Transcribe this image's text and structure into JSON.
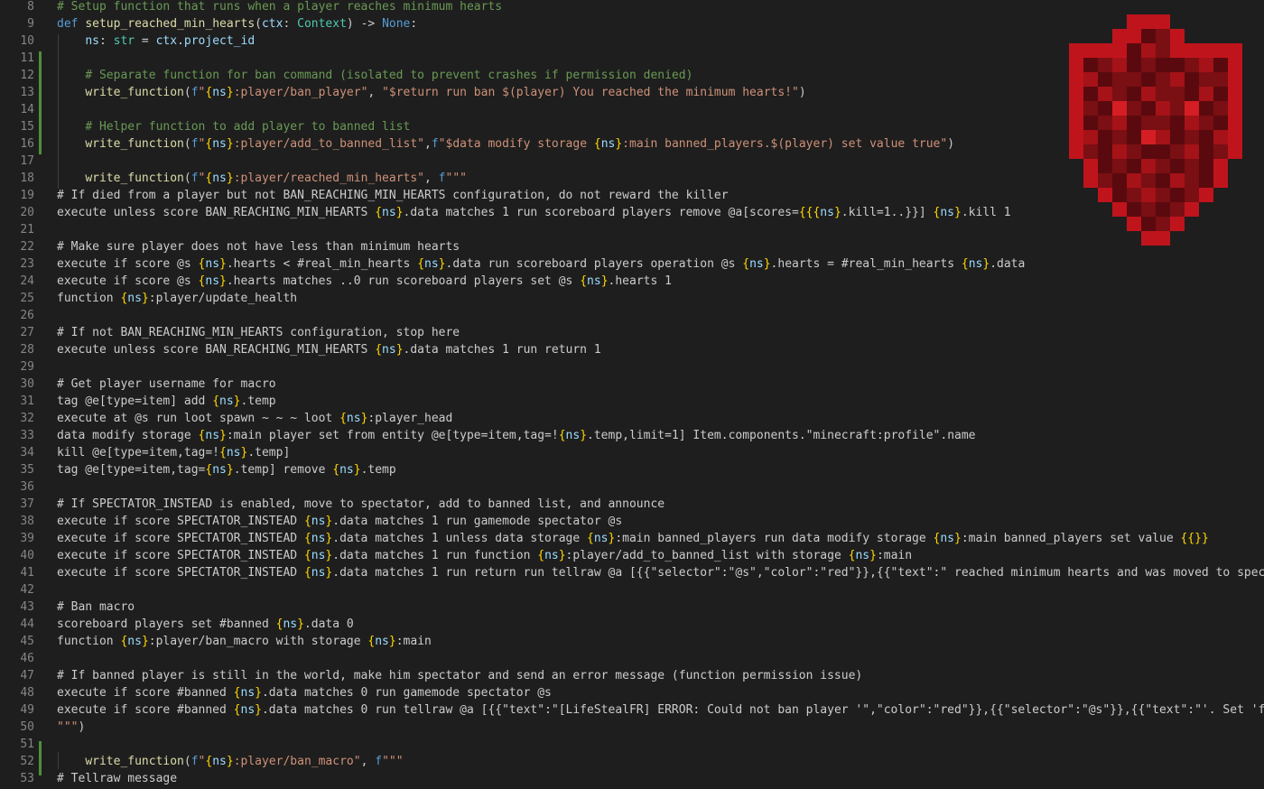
{
  "colors": {
    "background": "#1e1e1e",
    "line_number": "#858585",
    "comment": "#6a9955",
    "keyword": "#569cd6",
    "function": "#dcdcaa",
    "parameter": "#9cdcfe",
    "string": "#ce9178",
    "type": "#4ec9b0",
    "default": "#cccccc",
    "brace": "#ffd700",
    "added_line_marker": "#4e8f3a"
  },
  "logo_icon": "red-pixel-heart-shield-icon",
  "lines": [
    {
      "num": "8",
      "tokens": [
        {
          "c": "c",
          "text": "# Setup function that runs when a player reaches minimum hearts"
        }
      ]
    },
    {
      "num": "9",
      "tokens": [
        {
          "c": "k",
          "text": "def "
        },
        {
          "c": "f",
          "text": "setup_reached_min_hearts"
        },
        {
          "c": "d",
          "text": "("
        },
        {
          "c": "p",
          "text": "ctx"
        },
        {
          "c": "d",
          "text": ": "
        },
        {
          "c": "t",
          "text": "Context"
        },
        {
          "c": "d",
          "text": ") -> "
        },
        {
          "c": "n",
          "text": "None"
        },
        {
          "c": "d",
          "text": ":"
        }
      ]
    },
    {
      "num": "10",
      "tokens": [
        {
          "c": "d",
          "text": "    "
        },
        {
          "c": "p",
          "text": "ns"
        },
        {
          "c": "d",
          "text": ": "
        },
        {
          "c": "t",
          "text": "str"
        },
        {
          "c": "d",
          "text": " = "
        },
        {
          "c": "p",
          "text": "ctx"
        },
        {
          "c": "d",
          "text": "."
        },
        {
          "c": "p",
          "text": "project_id"
        }
      ]
    },
    {
      "num": "11",
      "tokens": []
    },
    {
      "num": "12",
      "tokens": [
        {
          "c": "d",
          "text": "    "
        },
        {
          "c": "c",
          "text": "# Separate function for ban command (isolated to prevent crashes if permission denied)"
        }
      ]
    },
    {
      "num": "13",
      "tokens": [
        {
          "c": "d",
          "text": "    "
        },
        {
          "c": "f",
          "text": "write_function"
        },
        {
          "c": "d",
          "text": "("
        },
        {
          "c": "k",
          "text": "f"
        },
        {
          "c": "s",
          "text": "\""
        },
        {
          "c": "y",
          "text": "{"
        },
        {
          "c": "p",
          "text": "ns"
        },
        {
          "c": "y",
          "text": "}"
        },
        {
          "c": "s",
          "text": ":player/ban_player\""
        },
        {
          "c": "d",
          "text": ", "
        },
        {
          "c": "s",
          "text": "\"$return run ban $(player) You reached the minimum hearts!\""
        },
        {
          "c": "d",
          "text": ")"
        }
      ]
    },
    {
      "num": "14",
      "tokens": []
    },
    {
      "num": "15",
      "tokens": [
        {
          "c": "d",
          "text": "    "
        },
        {
          "c": "c",
          "text": "# Helper function to add player to banned list"
        }
      ]
    },
    {
      "num": "16",
      "tokens": [
        {
          "c": "d",
          "text": "    "
        },
        {
          "c": "f",
          "text": "write_function"
        },
        {
          "c": "d",
          "text": "("
        },
        {
          "c": "k",
          "text": "f"
        },
        {
          "c": "s",
          "text": "\""
        },
        {
          "c": "y",
          "text": "{"
        },
        {
          "c": "p",
          "text": "ns"
        },
        {
          "c": "y",
          "text": "}"
        },
        {
          "c": "s",
          "text": ":player/add_to_banned_list\""
        },
        {
          "c": "d",
          "text": ","
        },
        {
          "c": "k",
          "text": "f"
        },
        {
          "c": "s",
          "text": "\"$data modify storage "
        },
        {
          "c": "y",
          "text": "{"
        },
        {
          "c": "p",
          "text": "ns"
        },
        {
          "c": "y",
          "text": "}"
        },
        {
          "c": "s",
          "text": ":main banned_players.$(player) set value true\""
        },
        {
          "c": "d",
          "text": ")"
        }
      ]
    },
    {
      "num": "17",
      "tokens": []
    },
    {
      "num": "18",
      "tokens": [
        {
          "c": "d",
          "text": "    "
        },
        {
          "c": "f",
          "text": "write_function"
        },
        {
          "c": "d",
          "text": "("
        },
        {
          "c": "k",
          "text": "f"
        },
        {
          "c": "s",
          "text": "\""
        },
        {
          "c": "y",
          "text": "{"
        },
        {
          "c": "p",
          "text": "ns"
        },
        {
          "c": "y",
          "text": "}"
        },
        {
          "c": "s",
          "text": ":player/reached_min_hearts\""
        },
        {
          "c": "d",
          "text": ", "
        },
        {
          "c": "k",
          "text": "f"
        },
        {
          "c": "s",
          "text": "\"\"\""
        }
      ]
    },
    {
      "num": "19",
      "tokens": [
        {
          "c": "d",
          "text": "# If died from a player but not BAN_REACHING_MIN_HEARTS configuration, do not reward the killer"
        }
      ]
    },
    {
      "num": "20",
      "tokens": [
        {
          "c": "d",
          "text": "execute unless score BAN_REACHING_MIN_HEARTS "
        },
        {
          "c": "y",
          "text": "{"
        },
        {
          "c": "p",
          "text": "ns"
        },
        {
          "c": "y",
          "text": "}"
        },
        {
          "c": "d",
          "text": ".data matches 1 run scoreboard players remove @a[scores="
        },
        {
          "c": "y",
          "text": "{{{"
        },
        {
          "c": "p",
          "text": "ns"
        },
        {
          "c": "y",
          "text": "}"
        },
        {
          "c": "d",
          "text": ".kill=1..}}] "
        },
        {
          "c": "y",
          "text": "{"
        },
        {
          "c": "p",
          "text": "ns"
        },
        {
          "c": "y",
          "text": "}"
        },
        {
          "c": "d",
          "text": ".kill 1"
        }
      ]
    },
    {
      "num": "21",
      "tokens": []
    },
    {
      "num": "22",
      "tokens": [
        {
          "c": "d",
          "text": "# Make sure player does not have less than minimum hearts"
        }
      ]
    },
    {
      "num": "23",
      "tokens": [
        {
          "c": "d",
          "text": "execute if score @s "
        },
        {
          "c": "y",
          "text": "{"
        },
        {
          "c": "p",
          "text": "ns"
        },
        {
          "c": "y",
          "text": "}"
        },
        {
          "c": "d",
          "text": ".hearts < #real_min_hearts "
        },
        {
          "c": "y",
          "text": "{"
        },
        {
          "c": "p",
          "text": "ns"
        },
        {
          "c": "y",
          "text": "}"
        },
        {
          "c": "d",
          "text": ".data run scoreboard players operation @s "
        },
        {
          "c": "y",
          "text": "{"
        },
        {
          "c": "p",
          "text": "ns"
        },
        {
          "c": "y",
          "text": "}"
        },
        {
          "c": "d",
          "text": ".hearts = #real_min_hearts "
        },
        {
          "c": "y",
          "text": "{"
        },
        {
          "c": "p",
          "text": "ns"
        },
        {
          "c": "y",
          "text": "}"
        },
        {
          "c": "d",
          "text": ".data"
        }
      ]
    },
    {
      "num": "24",
      "tokens": [
        {
          "c": "d",
          "text": "execute if score @s "
        },
        {
          "c": "y",
          "text": "{"
        },
        {
          "c": "p",
          "text": "ns"
        },
        {
          "c": "y",
          "text": "}"
        },
        {
          "c": "d",
          "text": ".hearts matches ..0 run scoreboard players set @s "
        },
        {
          "c": "y",
          "text": "{"
        },
        {
          "c": "p",
          "text": "ns"
        },
        {
          "c": "y",
          "text": "}"
        },
        {
          "c": "d",
          "text": ".hearts 1"
        }
      ]
    },
    {
      "num": "25",
      "tokens": [
        {
          "c": "d",
          "text": "function "
        },
        {
          "c": "y",
          "text": "{"
        },
        {
          "c": "p",
          "text": "ns"
        },
        {
          "c": "y",
          "text": "}"
        },
        {
          "c": "d",
          "text": ":player/update_health"
        }
      ]
    },
    {
      "num": "26",
      "tokens": []
    },
    {
      "num": "27",
      "tokens": [
        {
          "c": "d",
          "text": "# If not BAN_REACHING_MIN_HEARTS configuration, stop here"
        }
      ]
    },
    {
      "num": "28",
      "tokens": [
        {
          "c": "d",
          "text": "execute unless score BAN_REACHING_MIN_HEARTS "
        },
        {
          "c": "y",
          "text": "{"
        },
        {
          "c": "p",
          "text": "ns"
        },
        {
          "c": "y",
          "text": "}"
        },
        {
          "c": "d",
          "text": ".data matches 1 run return 1"
        }
      ]
    },
    {
      "num": "29",
      "tokens": []
    },
    {
      "num": "30",
      "tokens": [
        {
          "c": "d",
          "text": "# Get player username for macro"
        }
      ]
    },
    {
      "num": "31",
      "tokens": [
        {
          "c": "d",
          "text": "tag @e[type=item] add "
        },
        {
          "c": "y",
          "text": "{"
        },
        {
          "c": "p",
          "text": "ns"
        },
        {
          "c": "y",
          "text": "}"
        },
        {
          "c": "d",
          "text": ".temp"
        }
      ]
    },
    {
      "num": "32",
      "tokens": [
        {
          "c": "d",
          "text": "execute at @s run loot spawn ~ ~ ~ loot "
        },
        {
          "c": "y",
          "text": "{"
        },
        {
          "c": "p",
          "text": "ns"
        },
        {
          "c": "y",
          "text": "}"
        },
        {
          "c": "d",
          "text": ":player_head"
        }
      ]
    },
    {
      "num": "33",
      "tokens": [
        {
          "c": "d",
          "text": "data modify storage "
        },
        {
          "c": "y",
          "text": "{"
        },
        {
          "c": "p",
          "text": "ns"
        },
        {
          "c": "y",
          "text": "}"
        },
        {
          "c": "d",
          "text": ":main player set from entity @e[type=item,tag=!"
        },
        {
          "c": "y",
          "text": "{"
        },
        {
          "c": "p",
          "text": "ns"
        },
        {
          "c": "y",
          "text": "}"
        },
        {
          "c": "d",
          "text": ".temp,limit=1] Item.components.\"minecraft:profile\".name"
        }
      ]
    },
    {
      "num": "34",
      "tokens": [
        {
          "c": "d",
          "text": "kill @e[type=item,tag=!"
        },
        {
          "c": "y",
          "text": "{"
        },
        {
          "c": "p",
          "text": "ns"
        },
        {
          "c": "y",
          "text": "}"
        },
        {
          "c": "d",
          "text": ".temp]"
        }
      ]
    },
    {
      "num": "35",
      "tokens": [
        {
          "c": "d",
          "text": "tag @e[type=item,tag="
        },
        {
          "c": "y",
          "text": "{"
        },
        {
          "c": "p",
          "text": "ns"
        },
        {
          "c": "y",
          "text": "}"
        },
        {
          "c": "d",
          "text": ".temp] remove "
        },
        {
          "c": "y",
          "text": "{"
        },
        {
          "c": "p",
          "text": "ns"
        },
        {
          "c": "y",
          "text": "}"
        },
        {
          "c": "d",
          "text": ".temp"
        }
      ]
    },
    {
      "num": "36",
      "tokens": []
    },
    {
      "num": "37",
      "tokens": [
        {
          "c": "d",
          "text": "# If SPECTATOR_INSTEAD is enabled, move to spectator, add to banned list, and announce"
        }
      ]
    },
    {
      "num": "38",
      "tokens": [
        {
          "c": "d",
          "text": "execute if score SPECTATOR_INSTEAD "
        },
        {
          "c": "y",
          "text": "{"
        },
        {
          "c": "p",
          "text": "ns"
        },
        {
          "c": "y",
          "text": "}"
        },
        {
          "c": "d",
          "text": ".data matches 1 run gamemode spectator @s"
        }
      ]
    },
    {
      "num": "39",
      "tokens": [
        {
          "c": "d",
          "text": "execute if score SPECTATOR_INSTEAD "
        },
        {
          "c": "y",
          "text": "{"
        },
        {
          "c": "p",
          "text": "ns"
        },
        {
          "c": "y",
          "text": "}"
        },
        {
          "c": "d",
          "text": ".data matches 1 unless data storage "
        },
        {
          "c": "y",
          "text": "{"
        },
        {
          "c": "p",
          "text": "ns"
        },
        {
          "c": "y",
          "text": "}"
        },
        {
          "c": "d",
          "text": ":main banned_players run data modify storage "
        },
        {
          "c": "y",
          "text": "{"
        },
        {
          "c": "p",
          "text": "ns"
        },
        {
          "c": "y",
          "text": "}"
        },
        {
          "c": "d",
          "text": ":main banned_players set value "
        },
        {
          "c": "y",
          "text": "{{}}"
        }
      ]
    },
    {
      "num": "40",
      "tokens": [
        {
          "c": "d",
          "text": "execute if score SPECTATOR_INSTEAD "
        },
        {
          "c": "y",
          "text": "{"
        },
        {
          "c": "p",
          "text": "ns"
        },
        {
          "c": "y",
          "text": "}"
        },
        {
          "c": "d",
          "text": ".data matches 1 run function "
        },
        {
          "c": "y",
          "text": "{"
        },
        {
          "c": "p",
          "text": "ns"
        },
        {
          "c": "y",
          "text": "}"
        },
        {
          "c": "d",
          "text": ":player/add_to_banned_list with storage "
        },
        {
          "c": "y",
          "text": "{"
        },
        {
          "c": "p",
          "text": "ns"
        },
        {
          "c": "y",
          "text": "}"
        },
        {
          "c": "d",
          "text": ":main"
        }
      ]
    },
    {
      "num": "41",
      "tokens": [
        {
          "c": "d",
          "text": "execute if score SPECTATOR_INSTEAD "
        },
        {
          "c": "y",
          "text": "{"
        },
        {
          "c": "p",
          "text": "ns"
        },
        {
          "c": "y",
          "text": "}"
        },
        {
          "c": "d",
          "text": ".data matches 1 run return run tellraw @a [{{\"selector\":\"@s\",\"color\":\"red\"}},{{\"text\":\" reached minimum hearts and was moved to spectat"
        }
      ]
    },
    {
      "num": "42",
      "tokens": []
    },
    {
      "num": "43",
      "tokens": [
        {
          "c": "d",
          "text": "# Ban macro"
        }
      ]
    },
    {
      "num": "44",
      "tokens": [
        {
          "c": "d",
          "text": "scoreboard players set #banned "
        },
        {
          "c": "y",
          "text": "{"
        },
        {
          "c": "p",
          "text": "ns"
        },
        {
          "c": "y",
          "text": "}"
        },
        {
          "c": "d",
          "text": ".data 0"
        }
      ]
    },
    {
      "num": "45",
      "tokens": [
        {
          "c": "d",
          "text": "function "
        },
        {
          "c": "y",
          "text": "{"
        },
        {
          "c": "p",
          "text": "ns"
        },
        {
          "c": "y",
          "text": "}"
        },
        {
          "c": "d",
          "text": ":player/ban_macro with storage "
        },
        {
          "c": "y",
          "text": "{"
        },
        {
          "c": "p",
          "text": "ns"
        },
        {
          "c": "y",
          "text": "}"
        },
        {
          "c": "d",
          "text": ":main"
        }
      ]
    },
    {
      "num": "46",
      "tokens": []
    },
    {
      "num": "47",
      "tokens": [
        {
          "c": "d",
          "text": "# If banned player is still in the world, make him spectator and send an error message (function permission issue)"
        }
      ]
    },
    {
      "num": "48",
      "tokens": [
        {
          "c": "d",
          "text": "execute if score #banned "
        },
        {
          "c": "y",
          "text": "{"
        },
        {
          "c": "p",
          "text": "ns"
        },
        {
          "c": "y",
          "text": "}"
        },
        {
          "c": "d",
          "text": ".data matches 0 run gamemode spectator @s"
        }
      ]
    },
    {
      "num": "49",
      "tokens": [
        {
          "c": "d",
          "text": "execute if score #banned "
        },
        {
          "c": "y",
          "text": "{"
        },
        {
          "c": "p",
          "text": "ns"
        },
        {
          "c": "y",
          "text": "}"
        },
        {
          "c": "d",
          "text": ".data matches 0 run tellraw @a [{{\"text\":\"[LifeStealFR] ERROR: Could not ban player '\",\"color\":\"red\"}},{{\"selector\":\"@s\"}},{{\"text\":\"'. Set 'func"
        }
      ]
    },
    {
      "num": "50",
      "tokens": [
        {
          "c": "s",
          "text": "\"\"\""
        },
        {
          "c": "d",
          "text": ")"
        }
      ]
    },
    {
      "num": "51",
      "tokens": []
    },
    {
      "num": "52",
      "tokens": [
        {
          "c": "d",
          "text": "    "
        },
        {
          "c": "f",
          "text": "write_function"
        },
        {
          "c": "d",
          "text": "("
        },
        {
          "c": "k",
          "text": "f"
        },
        {
          "c": "s",
          "text": "\""
        },
        {
          "c": "y",
          "text": "{"
        },
        {
          "c": "p",
          "text": "ns"
        },
        {
          "c": "y",
          "text": "}"
        },
        {
          "c": "s",
          "text": ":player/ban_macro\""
        },
        {
          "c": "d",
          "text": ", "
        },
        {
          "c": "k",
          "text": "f"
        },
        {
          "c": "s",
          "text": "\"\"\""
        }
      ]
    },
    {
      "num": "53",
      "tokens": [
        {
          "c": "d",
          "text": "# Tellraw message"
        }
      ]
    }
  ]
}
